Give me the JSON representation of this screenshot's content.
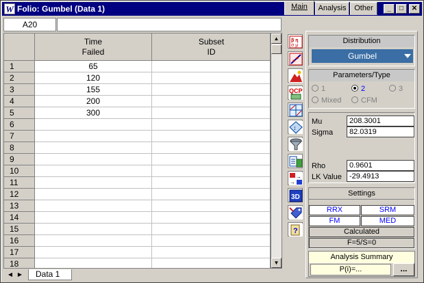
{
  "window": {
    "title": "Folio: Gumbel (Data 1)",
    "app_icon": "W"
  },
  "name_box": "A20",
  "formula_bar": "",
  "grid": {
    "headers": [
      {
        "line1": "Time",
        "line2": "Failed"
      },
      {
        "line1": "Subset",
        "line2": "ID"
      }
    ],
    "rows": [
      {
        "num": "1",
        "time": "65",
        "subset": ""
      },
      {
        "num": "2",
        "time": "120",
        "subset": ""
      },
      {
        "num": "3",
        "time": "155",
        "subset": ""
      },
      {
        "num": "4",
        "time": "200",
        "subset": ""
      },
      {
        "num": "5",
        "time": "300",
        "subset": ""
      },
      {
        "num": "6",
        "time": "",
        "subset": ""
      },
      {
        "num": "7",
        "time": "",
        "subset": ""
      },
      {
        "num": "8",
        "time": "",
        "subset": ""
      },
      {
        "num": "9",
        "time": "",
        "subset": ""
      },
      {
        "num": "10",
        "time": "",
        "subset": ""
      },
      {
        "num": "11",
        "time": "",
        "subset": ""
      },
      {
        "num": "12",
        "time": "",
        "subset": ""
      },
      {
        "num": "13",
        "time": "",
        "subset": ""
      },
      {
        "num": "14",
        "time": "",
        "subset": ""
      },
      {
        "num": "15",
        "time": "",
        "subset": ""
      },
      {
        "num": "16",
        "time": "",
        "subset": ""
      },
      {
        "num": "17",
        "time": "",
        "subset": ""
      },
      {
        "num": "18",
        "time": "",
        "subset": ""
      }
    ]
  },
  "sheet_tab": "Data 1",
  "tabs": {
    "main": "Main",
    "analysis": "Analysis",
    "other": "Other"
  },
  "distribution": {
    "label": "Distribution",
    "value": "Gumbel"
  },
  "parameters": {
    "label": "Parameters/Type",
    "options": {
      "p1": "1",
      "p2": "2",
      "p3": "3",
      "mixed": "Mixed",
      "cfm": "CFM"
    },
    "selected": "2"
  },
  "results": {
    "mu_label": "Mu",
    "mu": "208.3001",
    "sigma_label": "Sigma",
    "sigma": "82.0319",
    "rho_label": "Rho",
    "rho": "0.9601",
    "lk_label": "LK Value",
    "lk": "-29.4913"
  },
  "settings": {
    "label": "Settings",
    "rrx": "RRX",
    "srm": "SRM",
    "fm": "FM",
    "med": "MED",
    "calculated": "Calculated",
    "fs": "F=5/S=0"
  },
  "summary": {
    "label": "Analysis Summary",
    "value": "P(i)=...",
    "button": "..."
  },
  "colors": {
    "titlebar": "#000080",
    "distribution_bg": "#3a6ea5",
    "link": "#0000ff",
    "summary_bg": "#ffffe0"
  }
}
